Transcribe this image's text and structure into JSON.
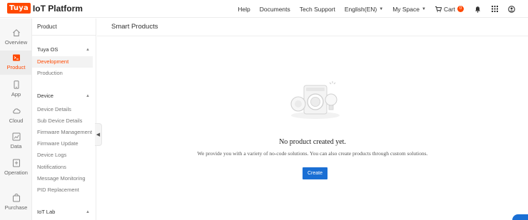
{
  "brand": {
    "badge": "Tuya",
    "title": "IoT Platform",
    "badge_color": "#ff4800"
  },
  "topnav": {
    "help": "Help",
    "documents": "Documents",
    "tech_support": "Tech Support",
    "language": "English(EN)",
    "my_space": "My Space",
    "cart": "Cart",
    "cart_count": "0",
    "icons": [
      "cart-icon",
      "bell-icon",
      "apps-grid-icon",
      "user-avatar-icon"
    ]
  },
  "rail": {
    "items": [
      {
        "label": "Overview",
        "icon": "house-icon"
      },
      {
        "label": "Product",
        "icon": "terminal-icon"
      },
      {
        "label": "App",
        "icon": "phone-icon"
      },
      {
        "label": "Cloud",
        "icon": "cloud-icon"
      },
      {
        "label": "Data",
        "icon": "chart-icon"
      },
      {
        "label": "Operation",
        "icon": "plus-box-icon"
      },
      {
        "label": "Purchase",
        "icon": "shop-icon"
      }
    ],
    "active": "Product"
  },
  "subnav": {
    "header": "Product",
    "groups": {
      "tuya_os": "Tuya OS",
      "device": "Device",
      "iot_lab": "IoT Lab"
    },
    "tuya_os_items": [
      "Development",
      "Production"
    ],
    "device_items": [
      "Device Details",
      "Sub Device Details",
      "Firmware Management",
      "Firmware Update",
      "Device Logs",
      "Notifications",
      "Message Monitoring",
      "PID Replacement"
    ],
    "active": "Development"
  },
  "main": {
    "title": "Smart Products",
    "empty_title": "No product created yet.",
    "empty_desc": "We provide you with a variety of no-code solutions. You can also create products through custom solutions.",
    "create_label": "Create",
    "accent": "#1a6fd4"
  }
}
